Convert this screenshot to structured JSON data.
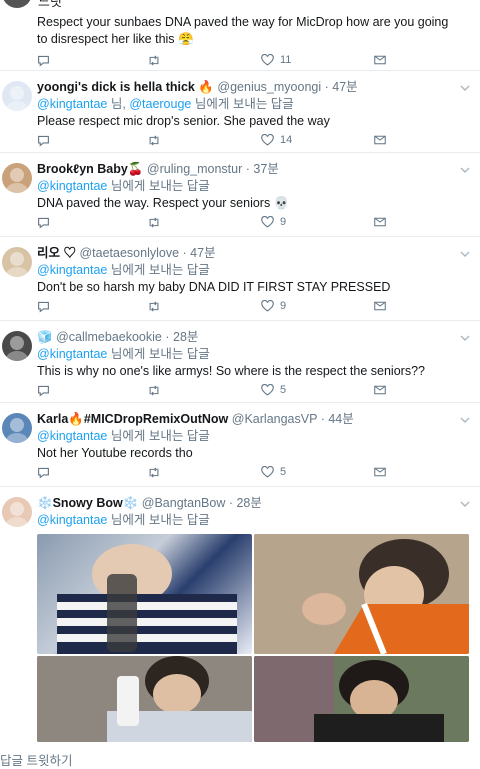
{
  "top_tweet": {
    "title_fragment": "느릿",
    "text": "Respect your sunbaes DNA paved the way for MicDrop how are you going to disrespect her like this 😤",
    "likes": "11"
  },
  "tweets": [
    {
      "name": "yoongi's dick is hella thick 🔥",
      "handle": "@genius_myoongi",
      "sep": "·",
      "time": "47분",
      "mention1": "@kingtantae",
      "mid": "님,",
      "mention2": "@taerouge",
      "suffix": "님에게 보내는 답글",
      "text": "Please respect mic drop's senior. She paved the way",
      "likes": "14"
    },
    {
      "name": "Brookℓyn Baby🍒",
      "handle": "@ruling_monstur",
      "sep": "·",
      "time": "37분",
      "mention1": "@kingtantae",
      "suffix": "님에게 보내는 답글",
      "text": "DNA paved the way. Respect your seniors 💀",
      "likes": "9"
    },
    {
      "name": "리오 ♡",
      "handle": "@taetaesonlylove",
      "sep": "·",
      "time": "47분",
      "mention1": "@kingtantae",
      "suffix": "님에게 보내는 답글",
      "text": "Don't be so harsh my baby DNA DID IT FIRST STAY PRESSED",
      "likes": "9"
    },
    {
      "name": "🧊",
      "handle": "@callmebaekookie",
      "sep": "·",
      "time": "28분",
      "mention1": "@kingtantae",
      "suffix": "님에게 보내는 답글",
      "text": "This is why no one's like armys! So where is the respect the seniors??",
      "likes": "5"
    },
    {
      "name": "Karla🔥#MICDropRemixOutNow",
      "handle": "@KarlangasVP",
      "sep": "·",
      "time": "44분",
      "mention1": "@kingtantae",
      "suffix": "님에게 보내는 답글",
      "text": "Not her Youtube records tho",
      "likes": "5"
    },
    {
      "name": "❄️Snowy Bow❄️",
      "handle": "@BangtanBow",
      "sep": "·",
      "time": "28분",
      "mention1": "@kingtantae",
      "suffix": "님에게 보내는 답글",
      "text": "",
      "likes": ""
    }
  ],
  "footer": {
    "label": "답글 트윗하기"
  },
  "colors": {
    "accent": "#1da1f2",
    "muted": "#657786",
    "text": "#14171a",
    "divider": "#e6ecf0"
  }
}
